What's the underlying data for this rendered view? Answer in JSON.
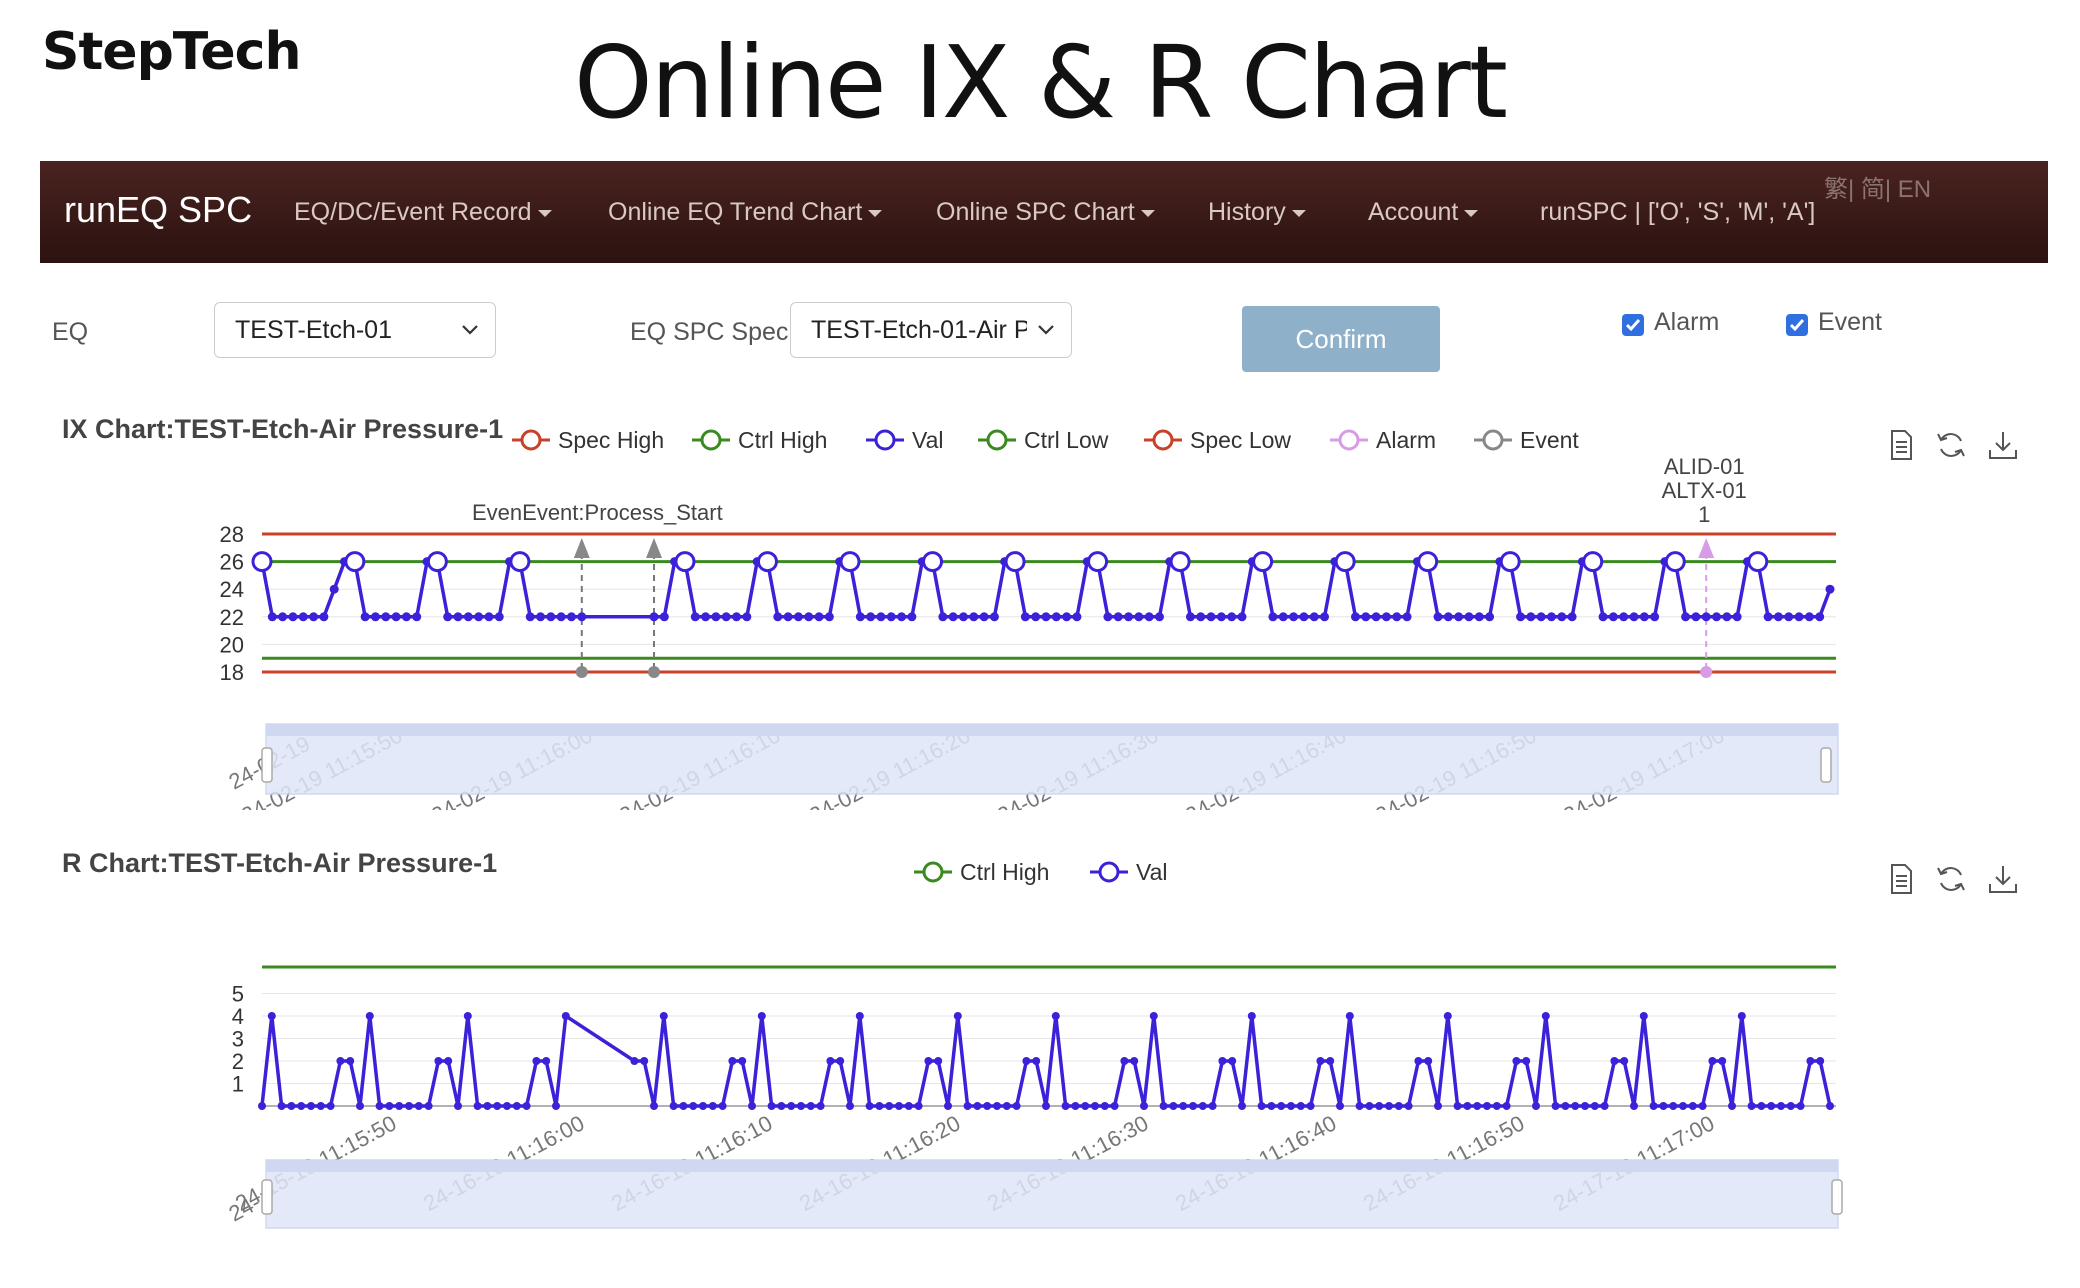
{
  "header": {
    "brand": "StepTech",
    "title": "Online IX & R Chart"
  },
  "navbar": {
    "brand": "runEQ SPC",
    "items": [
      {
        "label": "EQ/DC/Event Record"
      },
      {
        "label": "Online EQ Trend Chart"
      },
      {
        "label": "Online SPC Chart"
      },
      {
        "label": "History"
      },
      {
        "label": "Account"
      }
    ],
    "user": "runSPC | ['O', 'S', 'M', 'A']",
    "lang": "繁| 简| EN"
  },
  "form": {
    "eq_label": "EQ",
    "eq_value": "TEST-Etch-01",
    "spec_label": "EQ SPC Spec",
    "spec_value": "TEST-Etch-01-Air Pressure-1",
    "confirm_label": "Confirm",
    "alarm_label": "Alarm",
    "alarm_checked": true,
    "event_label": "Event",
    "event_checked": true
  },
  "icons": [
    "data-view-icon",
    "refresh-icon",
    "download-icon",
    "chevron-down-icon",
    "checkbox-icon"
  ],
  "colors": {
    "spec": "#c8422a",
    "ctrl": "#3a8a20",
    "val": "#3b22d8",
    "alarm": "#d89be6",
    "event": "#888888",
    "navbar": "#3a1a17",
    "button": "#8fb0c9"
  },
  "ix_chart": {
    "title": "IX Chart:TEST-Etch-Air Pressure-1",
    "legend": [
      "Spec High",
      "Ctrl High",
      "Val",
      "Ctrl Low",
      "Spec Low",
      "Alarm",
      "Event"
    ],
    "event_label": "EvenEvent:Process_Start",
    "alarm_label": [
      "ALID-01",
      "ALTX-01",
      "1"
    ],
    "y_ticks": [
      "28",
      "26",
      "24",
      "22",
      "20",
      "18"
    ],
    "x_ticks": [
      "24-02-19 11:15:50",
      "24-02-19 11:16:00",
      "24-02-19 11:16:10",
      "24-02-19 11:16:20",
      "24-02-19 11:16:30",
      "24-02-19 11:16:40",
      "24-02-19 11:16:50",
      "24-02-19 11:17:00"
    ],
    "zoom_start_label": "24-02-19"
  },
  "r_chart": {
    "title": "R Chart:TEST-Etch-Air Pressure-1",
    "legend": [
      "Ctrl High",
      "Val"
    ],
    "y_ticks": [
      "5",
      "4",
      "3",
      "2",
      "1"
    ],
    "x_ticks": [
      "24-15-19 11:15:50",
      "24-16-19 11:16:00",
      "24-16-19 11:16:10",
      "24-16-19 11:16:20",
      "24-16-19 11:16:30",
      "24-16-19 11:16:40",
      "24-16-19 11:16:50",
      "24-17-19 11:17:00"
    ],
    "zoom_start_label": "24-"
  },
  "chart_data": [
    {
      "type": "line",
      "title": "IX Chart:TEST-Etch-Air Pressure-1",
      "ylim": [
        18,
        28
      ],
      "limits": {
        "spec_high": 28,
        "ctrl_high": 26,
        "ctrl_low": 19,
        "spec_low": 18
      },
      "series": [
        {
          "name": "Val",
          "values": [
            26,
            22,
            22,
            22,
            22,
            22,
            22,
            24,
            26,
            26,
            22,
            22,
            22,
            22,
            22,
            22,
            26,
            26,
            22,
            22,
            22,
            22,
            22,
            22,
            26,
            26,
            22,
            22,
            22,
            22,
            22,
            22,
            26,
            26,
            22,
            22,
            22,
            22,
            22,
            22,
            26,
            26,
            22,
            22,
            22,
            22,
            22,
            22,
            26,
            26,
            22,
            22,
            22,
            22,
            22,
            22,
            26,
            26,
            22,
            22,
            22,
            22,
            22,
            22,
            26,
            26,
            22,
            22,
            22,
            22,
            22,
            22,
            26,
            26,
            22,
            22,
            22,
            22,
            22,
            22,
            26,
            26,
            22,
            22,
            22,
            22,
            22,
            22,
            26,
            26,
            22,
            22,
            22,
            22,
            22,
            22,
            26,
            26,
            22,
            22,
            22,
            22,
            22,
            22,
            26,
            26,
            22,
            22,
            22,
            22,
            22,
            22,
            26,
            26,
            22,
            22,
            22,
            22,
            22,
            22,
            26,
            26,
            22,
            22,
            22,
            22,
            22,
            22,
            26,
            26,
            22,
            22,
            22,
            22,
            22,
            22,
            26,
            26,
            22,
            22,
            22,
            22,
            22,
            22,
            26,
            26,
            22,
            22,
            22,
            22,
            22,
            22,
            24
          ]
        }
      ],
      "circled_points": [
        26,
        26,
        26,
        26,
        26,
        26,
        26,
        26,
        26,
        26,
        26,
        26,
        26,
        26,
        26,
        26
      ]
    },
    {
      "type": "line",
      "title": "R Chart:TEST-Etch-Air Pressure-1",
      "ylim": [
        0,
        5
      ],
      "limits": {
        "ctrl_high": 6
      },
      "series": [
        {
          "name": "Val",
          "values": [
            0,
            4,
            0,
            0,
            0,
            0,
            0,
            0,
            2,
            2,
            0,
            4,
            0,
            0,
            0,
            0,
            0,
            0,
            2,
            2,
            0,
            4,
            0,
            0,
            0,
            0,
            0,
            0,
            2,
            2,
            0,
            4,
            0,
            0,
            0,
            0,
            0,
            0,
            2,
            2,
            0,
            4,
            0,
            0,
            0,
            0,
            0,
            0,
            2,
            2,
            0,
            4,
            0,
            0,
            0,
            0,
            0,
            0,
            2,
            2,
            0,
            4,
            0,
            0,
            0,
            0,
            0,
            0,
            2,
            2,
            0,
            4,
            0,
            0,
            0,
            0,
            0,
            0,
            2,
            2,
            0,
            4,
            0,
            0,
            0,
            0,
            0,
            0,
            2,
            2,
            0,
            4,
            0,
            0,
            0,
            0,
            0,
            0,
            2,
            2,
            0,
            4,
            0,
            0,
            0,
            0,
            0,
            0,
            2,
            2,
            0,
            4,
            0,
            0,
            0,
            0,
            0,
            0,
            2,
            2,
            0,
            4,
            0,
            0,
            0,
            0,
            0,
            0,
            2,
            2,
            0,
            4,
            0,
            0,
            0,
            0,
            0,
            0,
            2,
            2,
            0,
            4,
            0,
            0,
            0,
            0,
            0,
            0,
            2,
            2,
            0,
            4,
            0,
            0,
            0,
            0,
            0,
            0,
            2,
            2,
            0
          ]
        }
      ]
    }
  ]
}
